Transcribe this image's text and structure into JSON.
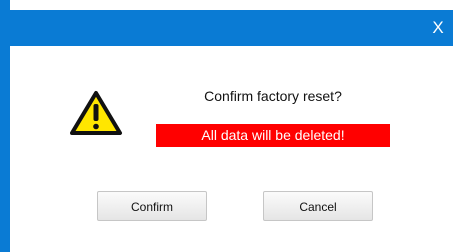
{
  "window": {
    "close_label": "X",
    "accent_color": "#0a7bd4"
  },
  "dialog": {
    "icon": "warning-icon",
    "message": "Confirm factory reset?",
    "alert": "All data will be deleted!",
    "alert_color": "#ff0000",
    "confirm_label": "Confirm",
    "cancel_label": "Cancel"
  }
}
